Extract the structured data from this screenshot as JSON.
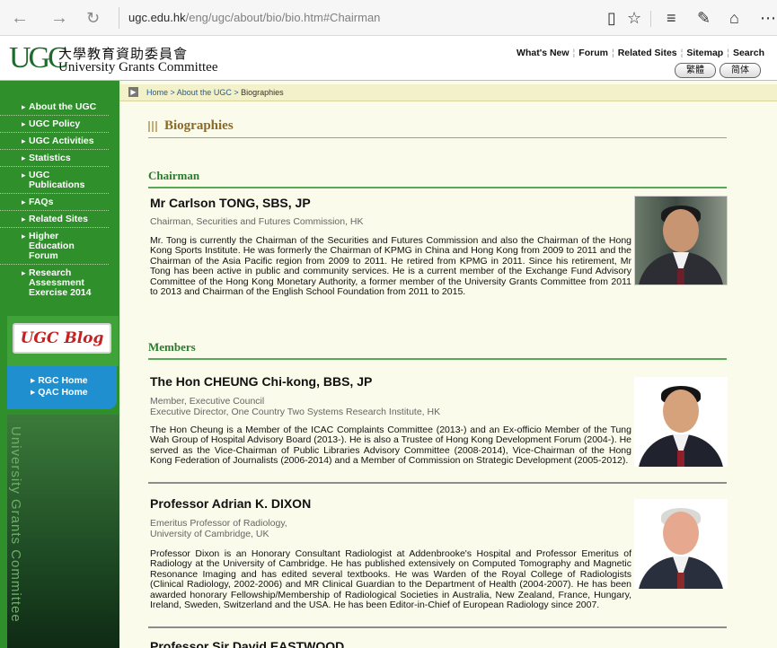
{
  "browser": {
    "url_domain": "ugc.edu.hk",
    "url_path": "/eng/ugc/about/bio/bio.htm#Chairman",
    "icons": [
      "back-icon",
      "forward-icon",
      "refresh-icon",
      "reading-view-icon",
      "favorite-star-icon",
      "hub-icon",
      "notes-pen-icon",
      "share-icon",
      "more-icon"
    ]
  },
  "header": {
    "logo_mark": "UGC",
    "name_cn": "大學教育資助委員會",
    "name_en": "University Grants Committee",
    "top_links": [
      "What's New",
      "Forum",
      "Related Sites",
      "Sitemap",
      "Search"
    ],
    "lang_buttons": [
      "繁體",
      "简体"
    ]
  },
  "sidebar": {
    "items": [
      {
        "label": "About the UGC"
      },
      {
        "label": "UGC Policy"
      },
      {
        "label": "UGC Activities"
      },
      {
        "label": "Statistics"
      },
      {
        "label": "UGC Publications"
      },
      {
        "label": "FAQs"
      },
      {
        "label": "Related Sites"
      },
      {
        "label": "Higher Education Forum"
      },
      {
        "label": "Research Assessment Exercise 2014"
      }
    ],
    "blog_label": "UGC Blog",
    "links": [
      "RGC Home",
      "QAC Home"
    ],
    "photo_caption": "University Grants Committee"
  },
  "breadcrumb": [
    "Home",
    "About the UGC",
    "Biographies"
  ],
  "page": {
    "title": "Biographies",
    "sections": {
      "chairman": "Chairman",
      "members": "Members"
    }
  },
  "people": [
    {
      "name": "Mr Carlson TONG, SBS, JP",
      "role": "Chairman, Securities and Futures Commission, HK",
      "bio": "Mr. Tong is currently the Chairman of the Securities and Futures Commission and also the Chairman of the Hong Kong Sports Institute. He was formerly the Chairman of KPMG in China and Hong Kong from 2009 to 2011 and the Chairman of the Asia Pacific region from 2009 to 2011. He retired from KPMG in 2011. Since his retirement, Mr Tong has been active in public and community services. He is a current member of the Exchange Fund Advisory Committee of the Hong Kong Monetary Authority, a former member of the University Grants Committee from 2011 to 2013 and Chairman of the English School Foundation from 2011 to 2015."
    },
    {
      "name": "The Hon CHEUNG Chi-kong, BBS, JP",
      "role": "Member, Executive Council",
      "role2": "Executive Director, One Country Two Systems Research Institute, HK",
      "bio": "The Hon Cheung is a Member of the ICAC Complaints Committee (2013-) and an Ex-officio Member of the Tung Wah Group of Hospital Advisory Board (2013-). He is also a Trustee of Hong Kong Development Forum (2004-). He served as the Vice-Chairman of Public Libraries Advisory Committee (2008-2014), Vice-Chairman of the Hong Kong Federation of Journalists (2006-2014) and a Member of Commission on Strategic Development (2005-2012)."
    },
    {
      "name": "Professor Adrian K. DIXON",
      "role": "Emeritus Professor of Radiology,",
      "role2": "University of Cambridge, UK",
      "bio": "Professor Dixon is an Honorary Consultant Radiologist at Addenbrooke's Hospital and Professor Emeritus of Radiology at the University of Cambridge. He has published extensively on Computed Tomography and Magnetic Resonance Imaging and has edited several textbooks. He was Warden of the Royal College of Radiologists (Clinical Radiology, 2002-2006) and MR Clinical Guardian to the Department of Health (2004-2007). He has been awarded honorary Fellowship/Membership of Radiological Societies in Australia, New Zealand, France, Hungary, Ireland, Sweden, Switzerland and the USA. He has been Editor-in-Chief of European Radiology since 2007."
    },
    {
      "name": "Professor Sir David EASTWOOD"
    }
  ]
}
